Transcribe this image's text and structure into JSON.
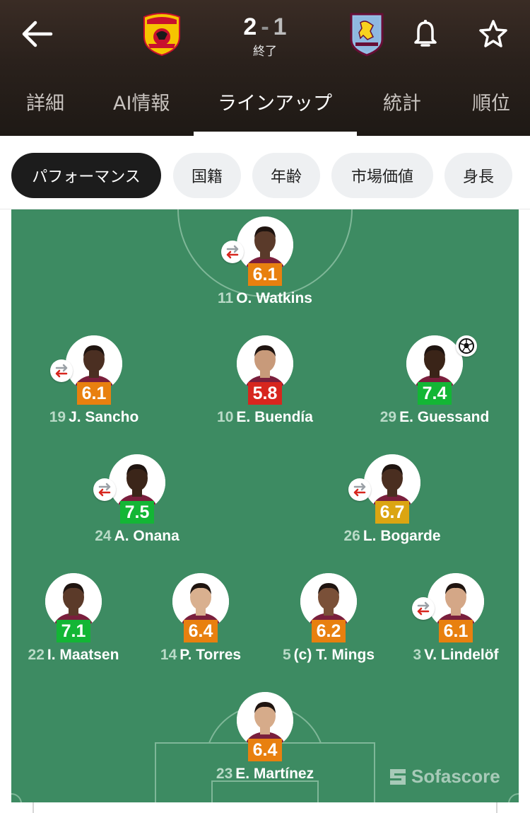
{
  "header": {
    "home_score": "2",
    "separator": "-",
    "away_score": "1",
    "status": "終了",
    "home_team_icon": "go-ahead-eagles-crest",
    "away_team_icon": "aston-villa-crest"
  },
  "tabs": [
    {
      "label": "詳細",
      "active": false
    },
    {
      "label": "AI情報",
      "active": false
    },
    {
      "label": "ラインアップ",
      "active": true
    },
    {
      "label": "統計",
      "active": false
    },
    {
      "label": "順位",
      "active": false
    }
  ],
  "filters": [
    {
      "label": "パフォーマンス",
      "active": true
    },
    {
      "label": "国籍",
      "active": false
    },
    {
      "label": "年齢",
      "active": false
    },
    {
      "label": "市場価値",
      "active": false
    },
    {
      "label": "身長",
      "active": false
    }
  ],
  "watermark": "Sofascore",
  "rating_colors": {
    "orange": "#e8800f",
    "red": "#d7261e",
    "green": "#13b635",
    "yellow": "#dba512"
  },
  "players": [
    {
      "number": "11",
      "name": "O. Watkins",
      "rating": "6.1",
      "rating_color": "#e8800f",
      "substituted": true,
      "goal": false
    },
    {
      "number": "19",
      "name": "J. Sancho",
      "rating": "6.1",
      "rating_color": "#e8800f",
      "substituted": true,
      "goal": false
    },
    {
      "number": "10",
      "name": "E. Buendía",
      "rating": "5.8",
      "rating_color": "#d7261e",
      "substituted": false,
      "goal": false
    },
    {
      "number": "29",
      "name": "E. Guessand",
      "rating": "7.4",
      "rating_color": "#13b635",
      "substituted": false,
      "goal": true
    },
    {
      "number": "24",
      "name": "A. Onana",
      "rating": "7.5",
      "rating_color": "#13b635",
      "substituted": true,
      "goal": false
    },
    {
      "number": "26",
      "name": "L. Bogarde",
      "rating": "6.7",
      "rating_color": "#dba512",
      "substituted": true,
      "goal": false
    },
    {
      "number": "22",
      "name": "I. Maatsen",
      "rating": "7.1",
      "rating_color": "#13b635",
      "substituted": false,
      "goal": false
    },
    {
      "number": "14",
      "name": "P. Torres",
      "rating": "6.4",
      "rating_color": "#e8800f",
      "substituted": false,
      "goal": false
    },
    {
      "number": "5",
      "name": "(c) T. Mings",
      "rating": "6.2",
      "rating_color": "#e8800f",
      "substituted": false,
      "goal": false
    },
    {
      "number": "3",
      "name": "V. Lindelöf",
      "rating": "6.1",
      "rating_color": "#e8800f",
      "substituted": true,
      "goal": false
    },
    {
      "number": "23",
      "name": "E. Martínez",
      "rating": "6.4",
      "rating_color": "#e8800f",
      "substituted": false,
      "goal": false
    }
  ]
}
